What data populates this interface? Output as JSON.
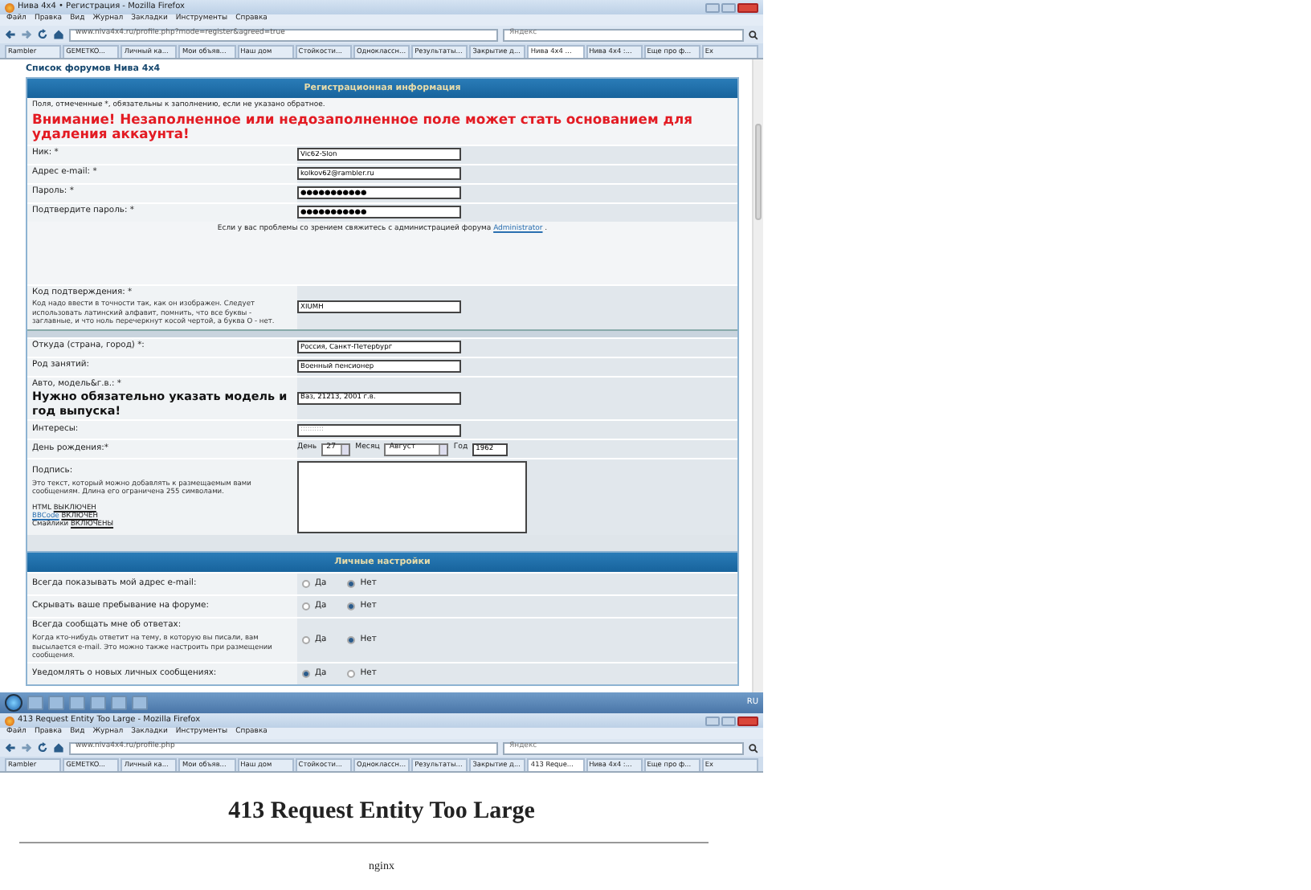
{
  "browser_top": {
    "window_title": "Нива 4х4 • Регистрация - Mozilla Firefox",
    "menu": [
      "Файл",
      "Правка",
      "Вид",
      "Журнал",
      "Закладки",
      "Инструменты",
      "Справка"
    ],
    "url": "www.niva4x4.ru/profile.php?mode=register&agreed=true",
    "search_placeholder": "Яндекс",
    "tabs": [
      {
        "label": "Rambler",
        "selected": false
      },
      {
        "label": "GEMETKO...",
        "selected": false
      },
      {
        "label": "Личный ка...",
        "selected": false
      },
      {
        "label": "Мои объяв...",
        "selected": false
      },
      {
        "label": "Наш дом",
        "selected": false
      },
      {
        "label": "Стойкости...",
        "selected": false
      },
      {
        "label": "Одноклассн...",
        "selected": false
      },
      {
        "label": "Результаты...",
        "selected": false
      },
      {
        "label": "Закрытие д...",
        "selected": false
      },
      {
        "label": "Нива 4х4 ...",
        "selected": true
      },
      {
        "label": "Нива 4х4 :...",
        "selected": false
      },
      {
        "label": "Еще про ф...",
        "selected": false
      },
      {
        "label": "Ex",
        "selected": false
      }
    ]
  },
  "breadcrumb": "Список форумов Нива 4х4",
  "registration": {
    "title": "Регистрационная информация",
    "note": "Поля, отмеченные *, обязательны к заполнению, если не указано обратное.",
    "warning": "Внимание! Незаполненное или недозаполненное поле может стать основанием для удаления аккаунта!",
    "rows": [
      {
        "kind": "field",
        "label": "Ник: *",
        "value": "Vic62-Slon"
      },
      {
        "kind": "field",
        "label": "Адрес e-mail: *",
        "value": "kolkov62@rambler.ru"
      },
      {
        "kind": "field",
        "label": "Пароль: *",
        "value": "●●●●●●●●●●●"
      },
      {
        "kind": "field",
        "label": "Подтвердите пароль: *",
        "value": "●●●●●●●●●●●"
      },
      {
        "kind": "notice",
        "text": "Если у вас проблемы со зрением свяжитесь с администрацией форума",
        "link": "Administrator",
        "after": "."
      },
      {
        "kind": "field",
        "label": "Код подтверждения: *",
        "hint": "Код надо ввести в точности так, как он изображен. Следует использовать латинский алфавит, помнить, что все буквы - заглавные, и что ноль перечеркнут косой чертой, а буква O - нет.",
        "value": "XIUMH"
      },
      {
        "kind": "seam"
      },
      {
        "kind": "field",
        "label": "Откуда (страна, город) *:",
        "value": "Россия, Санкт-Петербург"
      },
      {
        "kind": "field",
        "label": "Род занятий:",
        "value": "Военный пенсионер"
      },
      {
        "kind": "field",
        "label": "Авто, модель&г.в.: *",
        "note": "Нужно обязательно указать модель и год выпуска!",
        "value": "Ваз, 21213, 2001 г.в."
      },
      {
        "kind": "field",
        "label": "Интересы:",
        "placeholder": "::::::::::"
      },
      {
        "kind": "birthday",
        "label": "День рождения:*",
        "day_label": "День",
        "day": "27",
        "month_label": "Месяц",
        "month": "Август",
        "year_label": "Год",
        "year": "1962"
      },
      {
        "kind": "signature",
        "label": "Подпись:",
        "hint": "Это текст, который можно добавлять к размещаемым вами сообщениям. Длина его ограничена 255 символами.",
        "options": [
          {
            "name": "HTML",
            "value": "ВЫКЛЮЧЕН",
            "link": false
          },
          {
            "name": "BBCode",
            "value": "ВКЛЮЧЕН",
            "link": true
          },
          {
            "name": "Смайлики",
            "value": "ВКЛЮЧЕНЫ",
            "link": false
          }
        ]
      }
    ]
  },
  "settings": {
    "title": "Личные настройки",
    "rows": [
      {
        "label": "Всегда показывать мой адрес e-mail:",
        "options": [
          {
            "label": "Да",
            "selected": false
          },
          {
            "label": "Нет",
            "selected": true
          }
        ]
      },
      {
        "label": "Скрывать ваше пребывание на форуме:",
        "options": [
          {
            "label": "Да",
            "selected": false
          },
          {
            "label": "Нет",
            "selected": true
          }
        ]
      },
      {
        "label": "Всегда сообщать мне об ответах:",
        "hint": "Когда кто-нибудь ответит на тему, в которую вы писали, вам высылается e-mail. Это можно также настроить при размещении сообщения.",
        "options": [
          {
            "label": "Да",
            "selected": false
          },
          {
            "label": "Нет",
            "selected": true
          }
        ]
      },
      {
        "label": "Уведомлять о новых личных сообщениях:",
        "options": [
          {
            "label": "Да",
            "selected": true
          },
          {
            "label": "Нет",
            "selected": false
          }
        ]
      }
    ]
  },
  "taskbar": {
    "language": "RU"
  },
  "browser_bottom": {
    "window_title": "413 Request Entity Too Large - Mozilla Firefox",
    "menu": [
      "Файл",
      "Правка",
      "Вид",
      "Журнал",
      "Закладки",
      "Инструменты",
      "Справка"
    ],
    "url": "www.niva4x4.ru/profile.php",
    "search_placeholder": "Яндекс",
    "tabs": [
      {
        "label": "Rambler",
        "selected": false
      },
      {
        "label": "GEMETKO...",
        "selected": false
      },
      {
        "label": "Личный ка...",
        "selected": false
      },
      {
        "label": "Мои объяв...",
        "selected": false
      },
      {
        "label": "Наш дом",
        "selected": false
      },
      {
        "label": "Стойкости...",
        "selected": false
      },
      {
        "label": "Одноклассн...",
        "selected": false
      },
      {
        "label": "Результаты...",
        "selected": false
      },
      {
        "label": "Закрытие д...",
        "selected": false
      },
      {
        "label": "413 Reque...",
        "selected": true
      },
      {
        "label": "Нива 4х4 :...",
        "selected": false
      },
      {
        "label": "Еще про ф...",
        "selected": false
      },
      {
        "label": "Ex",
        "selected": false
      }
    ]
  },
  "error_page": {
    "heading": "413 Request Entity Too Large",
    "server": "nginx"
  }
}
